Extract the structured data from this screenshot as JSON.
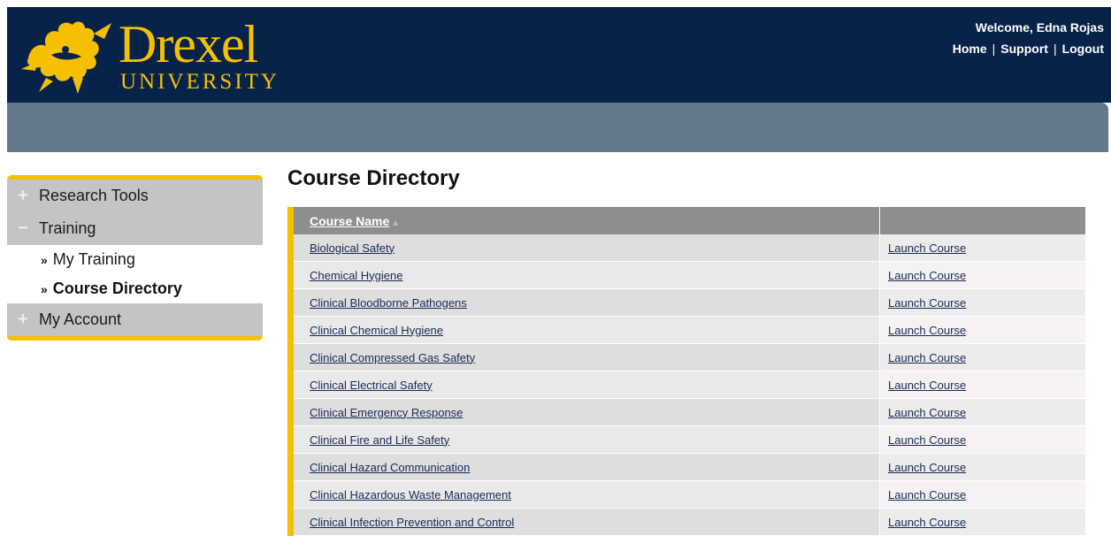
{
  "brand": {
    "name": "Drexel",
    "subtitle": "UNIVERSITY",
    "logo_icon": "dragon-icon",
    "colors": {
      "navy": "#07234a",
      "gold": "#f5c000",
      "slate": "#63788a"
    }
  },
  "header": {
    "welcome": "Welcome, Edna Rojas",
    "links": [
      "Home",
      "Support",
      "Logout"
    ]
  },
  "sidebar": {
    "items": [
      {
        "label": "Research Tools",
        "icon": "plus-icon"
      },
      {
        "label": "Training",
        "icon": "minus-icon",
        "children": [
          {
            "label": "My Training",
            "active": false
          },
          {
            "label": "Course Directory",
            "active": true
          }
        ]
      },
      {
        "label": "My Account",
        "icon": "plus-icon"
      }
    ]
  },
  "main": {
    "title": "Course Directory",
    "table": {
      "headers": [
        "Course Name",
        ""
      ],
      "sort_indicator": "ascending",
      "action_label": "Launch Course",
      "rows": [
        "Biological Safety",
        "Chemical Hygiene",
        "Clinical Bloodborne Pathogens",
        "Clinical Chemical Hygiene",
        "Clinical Compressed Gas Safety",
        "Clinical Electrical Safety",
        "Clinical Emergency Response",
        "Clinical Fire and Life Safety",
        "Clinical Hazard Communication",
        "Clinical Hazardous Waste Management",
        "Clinical Infection Prevention and Control"
      ]
    }
  }
}
